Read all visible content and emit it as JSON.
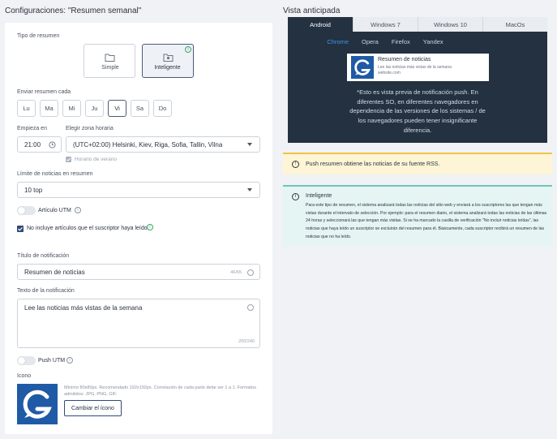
{
  "config": {
    "title": "Configuraciones: \"Resumen semanal\"",
    "summary_type_label": "Tipo de resumen",
    "type_simple": "Simple",
    "type_smart": "Inteligente",
    "send_every_label": "Enviar resumen cada",
    "days": [
      "Lu",
      "Ma",
      "Mi",
      "Ju",
      "Vi",
      "Sa",
      "Do"
    ],
    "selected_day": "Vi",
    "starts_label": "Empieza en",
    "start_time": "21:00",
    "timezone_label": "Elegir zona horaria",
    "timezone_value": "(UTC+02:00) Helsinki, Kiev, Riga, Sofia, Tallin, Vilna",
    "summer_time_label": "Horario de verano",
    "news_limit_label": "Límite de noticias en resumen",
    "news_limit_value": "10 top",
    "article_utm_label": "Artículo UTM",
    "exclude_read_label": "No incluye artículos que el suscriptor haya leído.",
    "notif_title_label": "Título de notificación",
    "notif_title_value": "Resumen de noticias",
    "notif_title_count": "46/65",
    "notif_text_label": "Texto de la notificación",
    "notif_text_value": "Lee las noticias más vistas de la semana",
    "notif_text_count": "200/240",
    "push_utm_label": "Push UTM",
    "icon_label": "Icono",
    "icon_help": "Mínimo 80x80px. Recomendado 192x192px. Correlación de cada parte debe ser 1 a 1. Formatos admitidos: JPG, PNG, GIF.",
    "change_icon_button": "Cambiar el ícono"
  },
  "preview": {
    "title": "Vista anticipada",
    "os_tabs": [
      "Android",
      "Windows 7",
      "Windows 10",
      "MacOs"
    ],
    "active_os": "Android",
    "browser_tabs": [
      "Chrome",
      "Opera",
      "Firefox",
      "Yandex"
    ],
    "active_browser": "Chrome",
    "notif_title": "Resumen de noticias",
    "notif_body": "Lee las noticias más vistas de la semana",
    "notif_site": "website.com",
    "disclaimer": "*Esto es vista previa de notificación push. En diferentes SO, en diferentes navegadores en dependencia de las versiones de los sistemas / de los navegadores pueden tener insignificante diferencia."
  },
  "alerts": {
    "warning_text": "Push resumen obtiene las noticias de su fuente RSS.",
    "info_title": "Inteligente",
    "info_text": "Para este tipo de resumen, el sistema analizará todas las noticias del sitio web y enviará a los suscriptores las que tengan más vistas durante el intervalo de selección. Por ejemplo: para el resumen diario, el sistema analizará todas las noticias de las últimas 24 horas y seleccionará las que tengan más visitas. Si se ha marcado la casilla de verificación \"No incluir noticias leídas\", las noticias que haya leído un suscriptor se excluirán del resumen para él. Básicamente, cada suscriptor recibirá un resumen de las noticias que no ha leído."
  },
  "colors": {
    "dark_panel": "#233141",
    "accent_blue": "#3f94e8",
    "warning_bg": "#fdf5d6",
    "info_bg": "#e5f5f4",
    "logo_blue": "#1f5aa6"
  }
}
